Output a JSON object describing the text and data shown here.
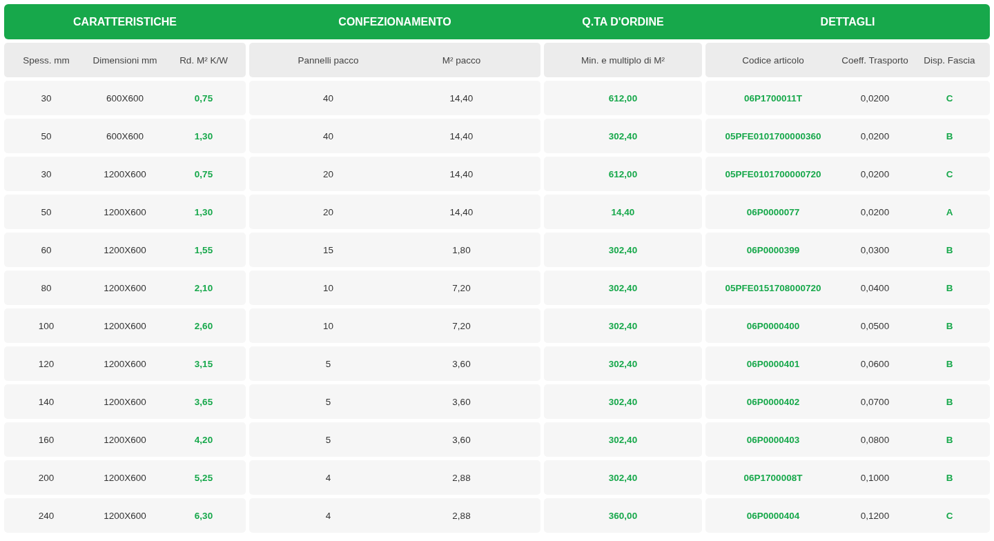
{
  "groups": [
    {
      "title": "CARATTERISTICHE",
      "columns": [
        {
          "label": "Spess. mm",
          "kind": "plain"
        },
        {
          "label": "Dimensioni mm",
          "kind": "plain"
        },
        {
          "label": "Rd. M² K/W",
          "kind": "highlight"
        }
      ]
    },
    {
      "title": "CONFEZIONAMENTO",
      "columns": [
        {
          "label": "Pannelli pacco",
          "kind": "plain"
        },
        {
          "label": "M² pacco",
          "kind": "plain"
        }
      ]
    },
    {
      "title": "Q.TA D'ORDINE",
      "columns": [
        {
          "label": "Min. e multiplo di M²",
          "kind": "highlight"
        }
      ]
    },
    {
      "title": "DETTAGLI",
      "columns": [
        {
          "label": "Codice articolo",
          "kind": "highlight"
        },
        {
          "label": "Coeff. Trasporto",
          "kind": "plain"
        },
        {
          "label": "Disp. Fascia",
          "kind": "highlight"
        }
      ]
    }
  ],
  "rows": [
    [
      "30",
      "600X600",
      "0,75",
      "40",
      "14,40",
      "612,00",
      "06P1700011T",
      "0,0200",
      "C"
    ],
    [
      "50",
      "600X600",
      "1,30",
      "40",
      "14,40",
      "302,40",
      "05PFE0101700000360",
      "0,0200",
      "B"
    ],
    [
      "30",
      "1200X600",
      "0,75",
      "20",
      "14,40",
      "612,00",
      "05PFE0101700000720",
      "0,0200",
      "C"
    ],
    [
      "50",
      "1200X600",
      "1,30",
      "20",
      "14,40",
      "14,40",
      "06P0000077",
      "0,0200",
      "A"
    ],
    [
      "60",
      "1200X600",
      "1,55",
      "15",
      "1,80",
      "302,40",
      "06P0000399",
      "0,0300",
      "B"
    ],
    [
      "80",
      "1200X600",
      "2,10",
      "10",
      "7,20",
      "302,40",
      "05PFE0151708000720",
      "0,0400",
      "B"
    ],
    [
      "100",
      "1200X600",
      "2,60",
      "10",
      "7,20",
      "302,40",
      "06P0000400",
      "0,0500",
      "B"
    ],
    [
      "120",
      "1200X600",
      "3,15",
      "5",
      "3,60",
      "302,40",
      "06P0000401",
      "0,0600",
      "B"
    ],
    [
      "140",
      "1200X600",
      "3,65",
      "5",
      "3,60",
      "302,40",
      "06P0000402",
      "0,0700",
      "B"
    ],
    [
      "160",
      "1200X600",
      "4,20",
      "5",
      "3,60",
      "302,40",
      "06P0000403",
      "0,0800",
      "B"
    ],
    [
      "200",
      "1200X600",
      "5,25",
      "4",
      "2,88",
      "302,40",
      "06P1700008T",
      "0,1000",
      "B"
    ],
    [
      "240",
      "1200X600",
      "6,30",
      "4",
      "2,88",
      "360,00",
      "06P0000404",
      "0,1200",
      "C"
    ]
  ]
}
